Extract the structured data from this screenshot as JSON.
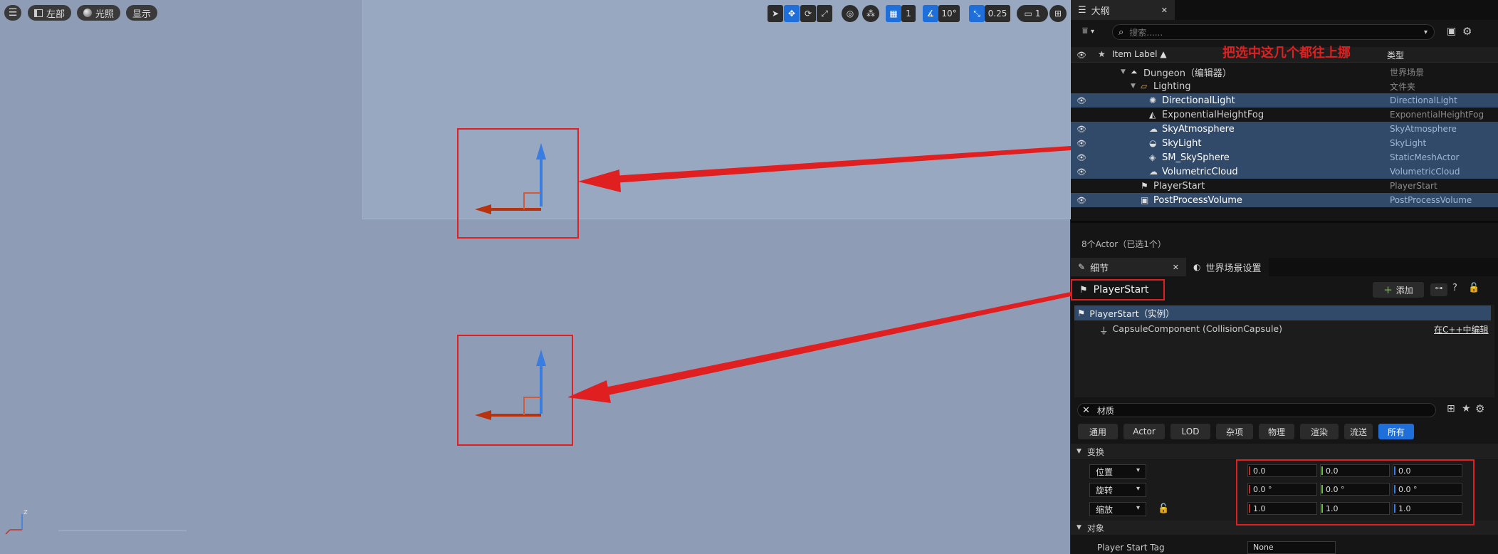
{
  "viewport": {
    "toolbar": {
      "menu_icon": "hamburger-icon",
      "left_view_label": "左部",
      "lighting_label": "光照",
      "show_label": "显示",
      "grid_value": "1",
      "rotation_snap_value": "10°",
      "scale_snap_value": "0.25",
      "camera_speed_value": "1"
    },
    "axis_label": "z"
  },
  "outliner": {
    "tab_title": "大纲",
    "search_placeholder": "搜索......",
    "col_item_label": "Item Label ▲",
    "col_type": "类型",
    "annotation": "把选中这几个都往上挪",
    "rows": [
      {
        "label": "Dungeon（编辑器）",
        "type": "世界场景",
        "selected": false,
        "eye": false
      },
      {
        "label": "Lighting",
        "type": "文件夹",
        "selected": false,
        "eye": false
      },
      {
        "label": "DirectionalLight",
        "type": "DirectionalLight",
        "selected": true,
        "eye": true
      },
      {
        "label": "ExponentialHeightFog",
        "type": "ExponentialHeightFog",
        "selected": false,
        "eye": false
      },
      {
        "label": "SkyAtmosphere",
        "type": "SkyAtmosphere",
        "selected": true,
        "eye": true
      },
      {
        "label": "SkyLight",
        "type": "SkyLight",
        "selected": true,
        "eye": true
      },
      {
        "label": "SM_SkySphere",
        "type": "StaticMeshActor",
        "selected": true,
        "eye": true
      },
      {
        "label": "VolumetricCloud",
        "type": "VolumetricCloud",
        "selected": true,
        "eye": true
      },
      {
        "label": "PlayerStart",
        "type": "PlayerStart",
        "selected": false,
        "eye": false
      },
      {
        "label": "PostProcessVolume",
        "type": "PostProcessVolume",
        "selected": true,
        "eye": true
      }
    ],
    "status": "8个Actor（已选1个）"
  },
  "details": {
    "tab_details": "细节",
    "tab_world": "世界场景设置",
    "actor_name": "PlayerStart",
    "add_label": "添加",
    "instance_label": "PlayerStart（实例）",
    "component_label": "CapsuleComponent (CollisionCapsule)",
    "edit_cpp_label": "在C++中编辑",
    "filter_value": "材质",
    "categories": [
      "通用",
      "Actor",
      "LOD",
      "杂项",
      "物理",
      "渲染",
      "流送",
      "所有"
    ],
    "transform_section": "变换",
    "location_label": "位置",
    "rotation_label": "旋转",
    "scale_label": "缩放",
    "location": [
      "0.0",
      "0.0",
      "0.0"
    ],
    "rotation": [
      "0.0 °",
      "0.0 °",
      "0.0 °"
    ],
    "scale": [
      "1.0",
      "1.0",
      "1.0"
    ],
    "object_section": "对象",
    "player_start_tag_label": "Player Start Tag",
    "player_start_tag_value": "None"
  },
  "colors": {
    "accent": "#1e6fd9",
    "selection": "#324a6a",
    "annotation_red": "#e02020",
    "viewport_bg": "#8e9cb5"
  }
}
